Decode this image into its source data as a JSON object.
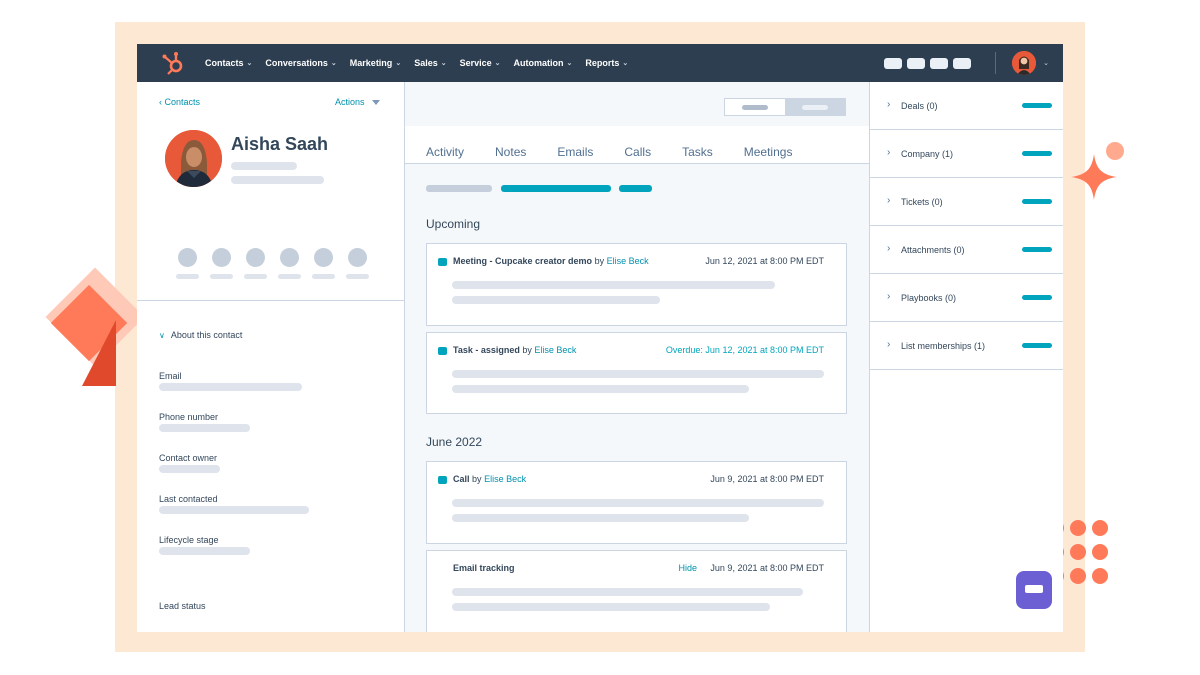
{
  "nav": {
    "items": [
      {
        "label": "Contacts"
      },
      {
        "label": "Conversations"
      },
      {
        "label": "Marketing"
      },
      {
        "label": "Sales"
      },
      {
        "label": "Service"
      },
      {
        "label": "Automation"
      },
      {
        "label": "Reports"
      }
    ],
    "chevron": "⌄",
    "icons": [
      "sprocket-logo-icon",
      "chevron-down-icon"
    ]
  },
  "contact": {
    "back_label": "Contacts",
    "actions_label": "Actions",
    "name": "Aisha Saah",
    "about_label": "About this contact",
    "fields": [
      "Email",
      "Phone number",
      "Contact owner",
      "Last contacted",
      "Lifecycle stage",
      "Lead status"
    ]
  },
  "tabs": [
    "Activity",
    "Notes",
    "Emails",
    "Calls",
    "Tasks",
    "Meetings"
  ],
  "timeline": {
    "upcoming_title": "Upcoming",
    "june_title": "June 2022",
    "cards": [
      {
        "type": "Meeting - Cupcake creator demo",
        "by": "by",
        "who": "Elise Beck",
        "date": "Jun 12, 2021 at 8:00 PM EDT"
      },
      {
        "type": "Task - assigned",
        "by": "by",
        "who": "Elise Beck",
        "date": "Overdue: Jun 12, 2021 at 8:00 PM EDT"
      },
      {
        "type": "Call",
        "by": "by",
        "who": "Elise Beck",
        "date": "Jun 9, 2021 at 8:00 PM EDT"
      },
      {
        "type": "Email tracking",
        "hide": "Hide",
        "date": "Jun 9, 2021 at 8:00 PM EDT"
      }
    ]
  },
  "sidebar": {
    "items": [
      "Deals (0)",
      "Company (1)",
      "Tickets (0)",
      "Attachments (0)",
      "Playbooks (0)",
      "List memberships (1)"
    ]
  },
  "colors": {
    "nav_bg": "#2d3e50",
    "accent": "#00a4bd",
    "link": "#0091ae",
    "brand_orange": "#ff7a59",
    "frame": "#fde8d4"
  }
}
